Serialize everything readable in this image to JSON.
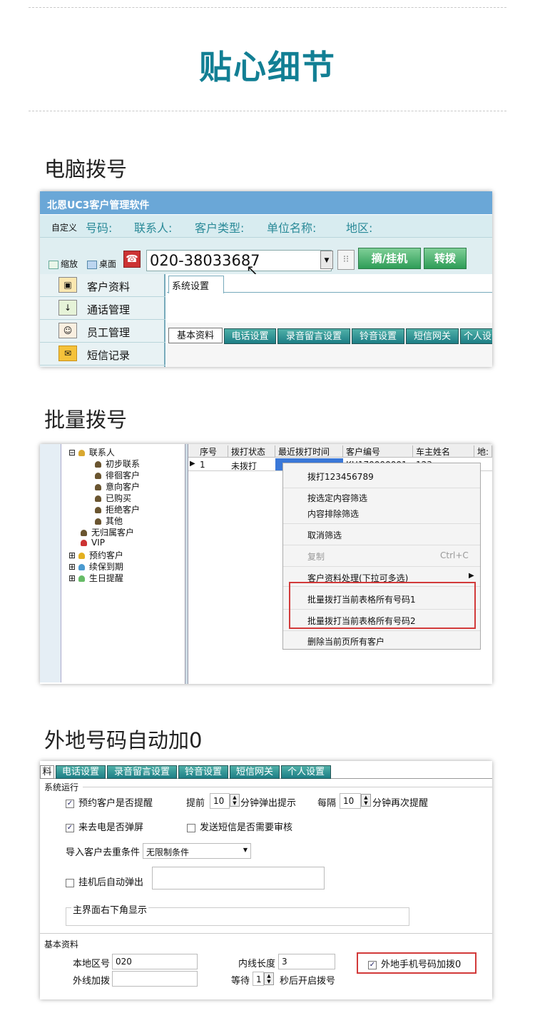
{
  "title": "贴心细节",
  "sections": {
    "s1": "电脑拨号",
    "s2": "批量拨号",
    "s3": "外地号码自动加0"
  },
  "app": {
    "title": "北恩UC3客户管理软件",
    "toolbar_custom": "自定义",
    "fields": [
      "号码:",
      "联系人:",
      "客户类型:",
      "单位名称:",
      "地区:"
    ],
    "chk_zoom": "缩放",
    "chk_desktop": "桌面",
    "dial_number": "020-38033687",
    "btn_pickup": "摘/挂机",
    "btn_transfer": "转拨",
    "nav": [
      "客户资料",
      "通话管理",
      "员工管理",
      "短信记录"
    ],
    "nav_icons": [
      "customer-icon",
      "call-icon",
      "staff-icon",
      "sms-icon"
    ],
    "panel_tab": "系统设置",
    "bottom_tabs": [
      "基本资料",
      "电话设置",
      "录音留言设置",
      "铃音设置",
      "短信网关",
      "个人设"
    ]
  },
  "batch": {
    "tree": [
      "联系人",
      "初步联系",
      "徘徊客户",
      "意向客户",
      "已购买",
      "拒绝客户",
      "其他",
      "无归属客户",
      "VIP",
      "预约客户",
      "续保到期",
      "生日提醒"
    ],
    "cols": [
      "序号",
      "拨打状态",
      "最近拨打时间",
      "客户编号",
      "车主姓名",
      "地:"
    ],
    "row": {
      "no": "1",
      "status": "未拨打",
      "cust_id": "KH170000001",
      "owner": "123"
    },
    "menu": {
      "dial": "拨打123456789",
      "filter_sel": "按选定内容筛选",
      "filter_ex": "内容排除筛选",
      "cancel": "取消筛选",
      "copy": "复制",
      "copy_key": "Ctrl+C",
      "process": "客户资料处理(下拉可多选)",
      "batch1": "批量拨打当前表格所有号码1",
      "batch2": "批量拨打当前表格所有号码2",
      "delete": "删除当前页所有客户"
    }
  },
  "settings": {
    "tabs": [
      "料",
      "电话设置",
      "录音留言设置",
      "铃音设置",
      "短信网关",
      "个人设置"
    ],
    "group1": "系统运行",
    "remind": "预约客户是否提醒",
    "ahead": "提前",
    "ahead_val": "10",
    "popup": "分钟弹出提示",
    "every": "每隔",
    "every_val": "10",
    "again": "分钟再次提醒",
    "popscreen": "来去电是否弹屏",
    "sms_review": "发送短信是否需要审核",
    "dedupe": "导入客户去重条件",
    "dedupe_val": "无限制条件",
    "hangup_popup": "挂机后自动弹出",
    "corner": "主界面右下角显示",
    "group2": "基本资料",
    "area": "本地区号",
    "area_val": "020",
    "line_len": "内线长度",
    "line_len_val": "3",
    "add0": "外地手机号码加拨0",
    "outer": "外线加拨",
    "wait": "等待",
    "wait_val": "1",
    "wait_after": "秒后开启拨号"
  }
}
